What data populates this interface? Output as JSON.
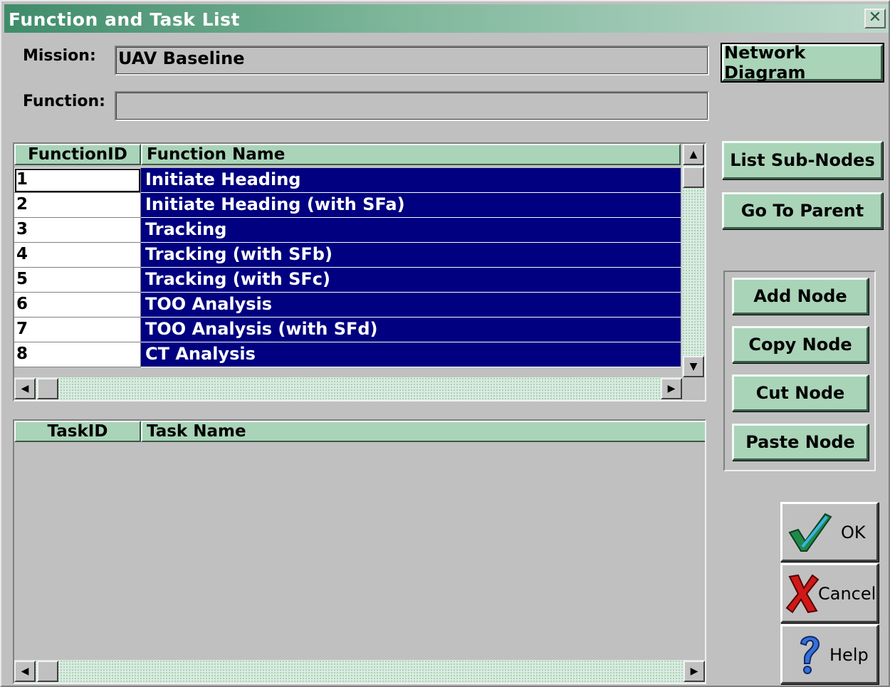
{
  "window": {
    "title": "Function and Task List",
    "close_glyph": "✕"
  },
  "mission": {
    "label": "Mission:",
    "value": "UAV Baseline"
  },
  "function": {
    "label": "Function:",
    "value": ""
  },
  "buttons": {
    "network_diagram": "Network Diagram",
    "list_sub_nodes": "List Sub-Nodes",
    "go_to_parent": "Go To Parent",
    "add_node": "Add Node",
    "copy_node": "Copy Node",
    "cut_node": "Cut Node",
    "paste_node": "Paste Node",
    "ok": "OK",
    "cancel": "Cancel",
    "help": "Help"
  },
  "function_grid": {
    "columns": [
      "FunctionID",
      "Function Name"
    ],
    "rows": [
      {
        "id": "1",
        "name": "Initiate Heading"
      },
      {
        "id": "2",
        "name": "Initiate Heading (with SFa)"
      },
      {
        "id": "3",
        "name": "Tracking"
      },
      {
        "id": "4",
        "name": "Tracking (with SFb)"
      },
      {
        "id": "5",
        "name": "Tracking (with SFc)"
      },
      {
        "id": "6",
        "name": "TOO Analysis"
      },
      {
        "id": "7",
        "name": "TOO Analysis (with SFd)"
      },
      {
        "id": "8",
        "name": "CT Analysis"
      }
    ]
  },
  "task_grid": {
    "columns": [
      "TaskID",
      "Task Name"
    ]
  },
  "icons": {
    "scroll_up": "▲",
    "scroll_down": "▼",
    "scroll_left": "◀",
    "scroll_right": "▶"
  },
  "colors": {
    "title_gradient_start": "#3f8c6a",
    "button_green": "#a9d4b8",
    "selection_navy": "#000080",
    "window_gray": "#c0c0c0"
  }
}
